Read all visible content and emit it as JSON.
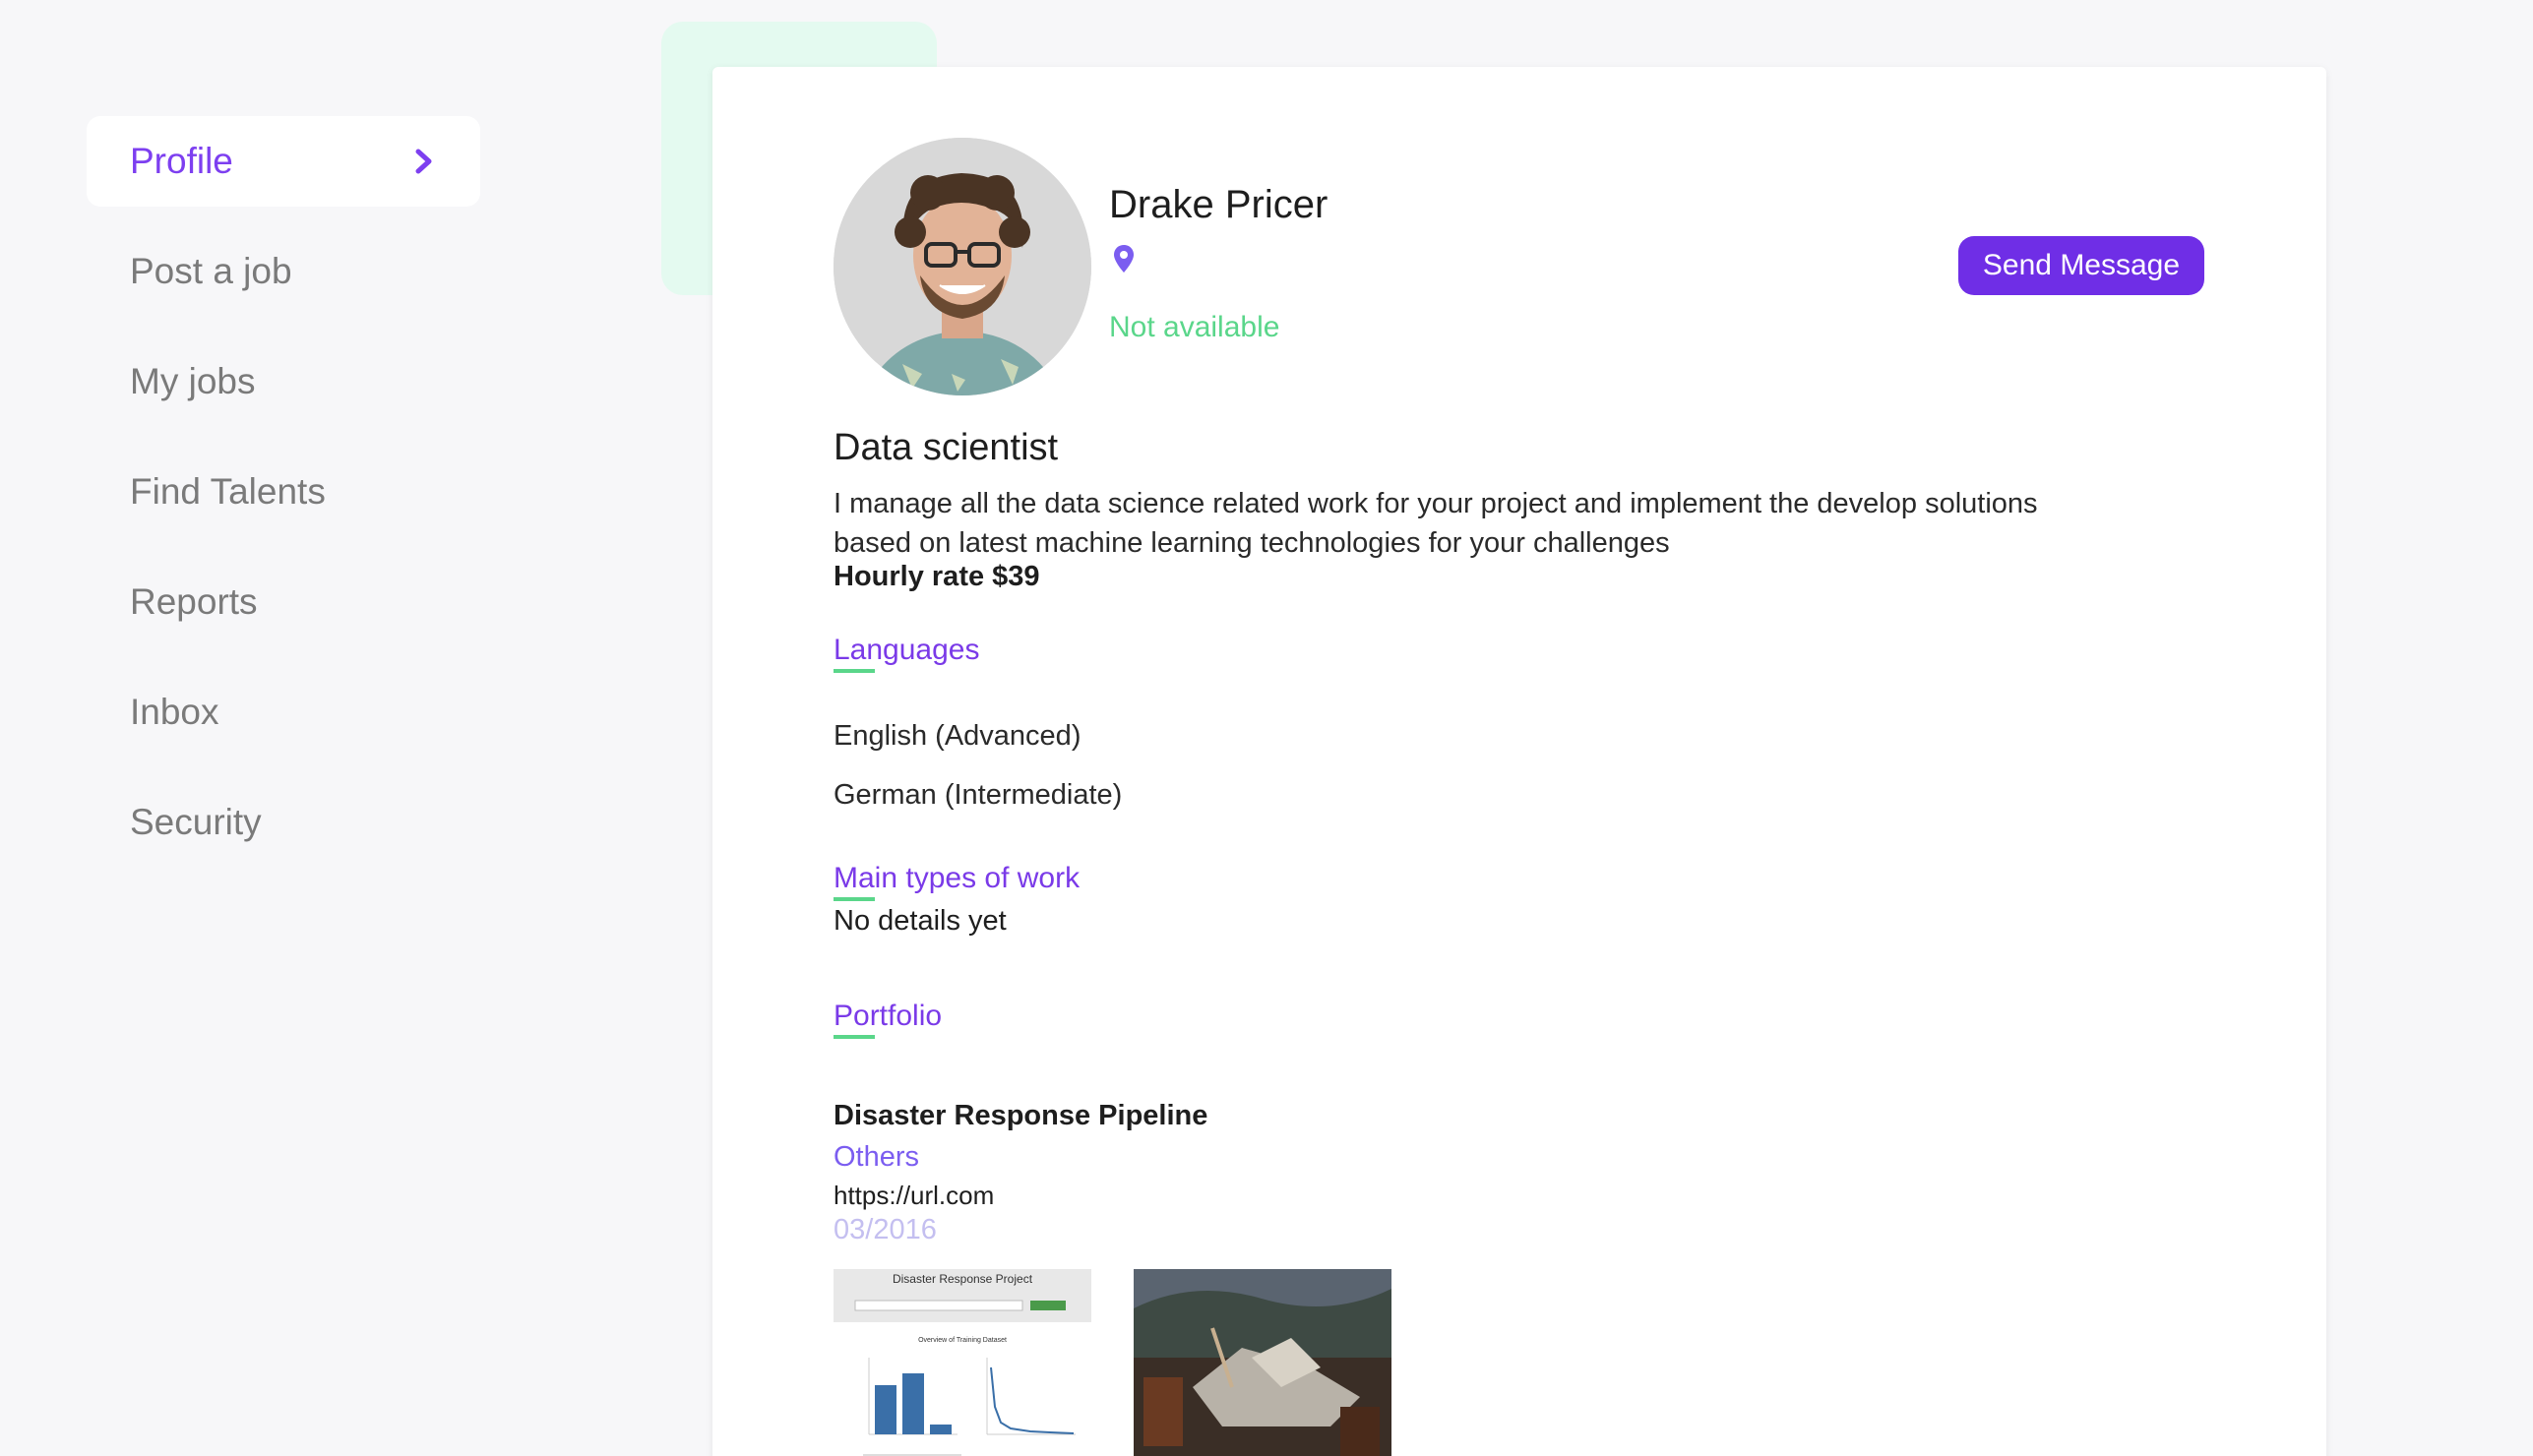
{
  "sidebar": {
    "items": [
      {
        "label": "Profile",
        "active": true
      },
      {
        "label": "Post a job"
      },
      {
        "label": "My jobs"
      },
      {
        "label": "Find Talents"
      },
      {
        "label": "Reports"
      },
      {
        "label": "Inbox"
      },
      {
        "label": "Security"
      }
    ]
  },
  "profile": {
    "name": "Drake Pricer",
    "availability": "Not available",
    "send_message_label": "Send Message",
    "title": "Data scientist",
    "description": "I manage all the data science related work for your project and implement the develop solutions based on latest machine learning technologies for your challenges",
    "hourly_rate": "Hourly rate $39"
  },
  "languages": {
    "heading": "Languages",
    "items": [
      "English (Advanced)",
      "German (Intermediate)"
    ]
  },
  "work_types": {
    "heading": "Main types of work",
    "text": "No details yet"
  },
  "portfolio": {
    "heading": "Portfolio",
    "project": {
      "title": "Disaster Response Pipeline",
      "category": "Others",
      "url": "https://url.com",
      "date": "03/2016",
      "thumb_caption": "Disaster Response Project",
      "thumb_chart_title": "Overview of Training Dataset"
    }
  },
  "colors": {
    "accent": "#6f2ee6",
    "available_green": "#5ad68a",
    "nav_inactive": "#7a7a7a"
  }
}
